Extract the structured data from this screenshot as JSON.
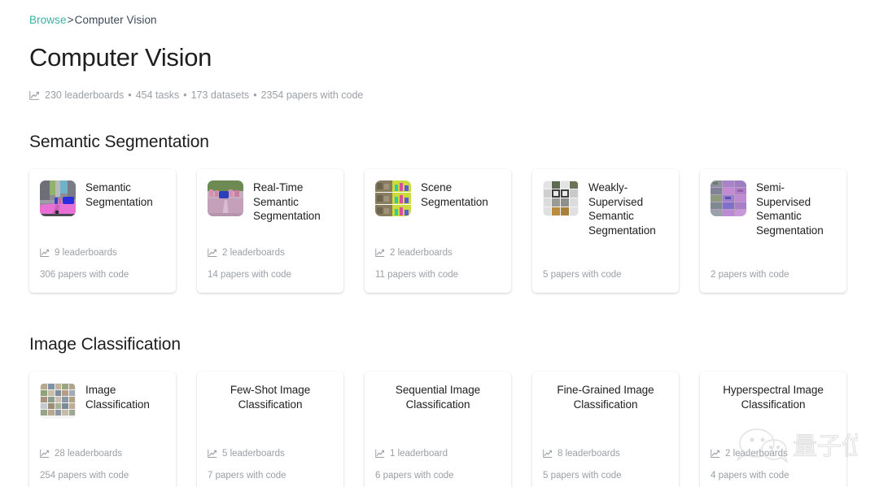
{
  "breadcrumb": {
    "root_label": "Browse",
    "separator": ">",
    "current_label": "Computer Vision"
  },
  "header": {
    "title": "Computer Vision",
    "stats_icon": "chart-line-icon",
    "stats": {
      "leaderboards": "230 leaderboards",
      "tasks": "454 tasks",
      "datasets": "173 datasets",
      "papers": "2354 papers with code",
      "separator": "•"
    }
  },
  "colors": {
    "link": "#38b2a3",
    "text": "#1e1e1e",
    "muted": "#9aa0a6",
    "card_bg": "#ffffff",
    "page_bg": "#ffffff"
  },
  "sections": [
    {
      "title": "Semantic Segmentation",
      "cards": [
        {
          "title": "Semantic Segmentation",
          "thumb": "street-scene-segmentation-thumbnail",
          "has_thumb": true,
          "leaderboards": "9 leaderboards",
          "papers": "306 papers with code"
        },
        {
          "title": "Real-Time Semantic Segmentation",
          "thumb": "realtime-street-segmentation-thumbnail",
          "has_thumb": true,
          "leaderboards": "2 leaderboards",
          "papers": "14 papers with code"
        },
        {
          "title": "Scene Segmentation",
          "thumb": "scene-segmentation-grid-thumbnail",
          "has_thumb": true,
          "leaderboards": "2 leaderboards",
          "papers": "11 papers with code"
        },
        {
          "title": "Weakly-Supervised Semantic Segmentation",
          "thumb": "weakly-supervised-grid-thumbnail",
          "has_thumb": true,
          "leaderboards": null,
          "papers": "5 papers with code"
        },
        {
          "title": "Semi-Supervised Semantic Segmentation",
          "thumb": "semi-supervised-grid-thumbnail",
          "has_thumb": true,
          "leaderboards": null,
          "papers": "2 papers with code"
        }
      ]
    },
    {
      "title": "Image Classification",
      "cards": [
        {
          "title": "Image Classification",
          "thumb": "imagenet-montage-thumbnail",
          "has_thumb": true,
          "leaderboards": "28 leaderboards",
          "papers": "254 papers with code"
        },
        {
          "title": "Few-Shot Image Classification",
          "thumb": null,
          "has_thumb": false,
          "leaderboards": "5 leaderboards",
          "papers": "7 papers with code"
        },
        {
          "title": "Sequential Image Classification",
          "thumb": null,
          "has_thumb": false,
          "leaderboards": "1 leaderboard",
          "papers": "6 papers with code"
        },
        {
          "title": "Fine-Grained Image Classification",
          "thumb": null,
          "has_thumb": false,
          "leaderboards": "8 leaderboards",
          "papers": "5 papers with code"
        },
        {
          "title": "Hyperspectral Image Classification",
          "thumb": null,
          "has_thumb": false,
          "leaderboards": "2 leaderboards",
          "papers": "4 papers with code"
        }
      ]
    }
  ],
  "watermark": {
    "icon": "wechat-icon",
    "text": "量子位"
  }
}
